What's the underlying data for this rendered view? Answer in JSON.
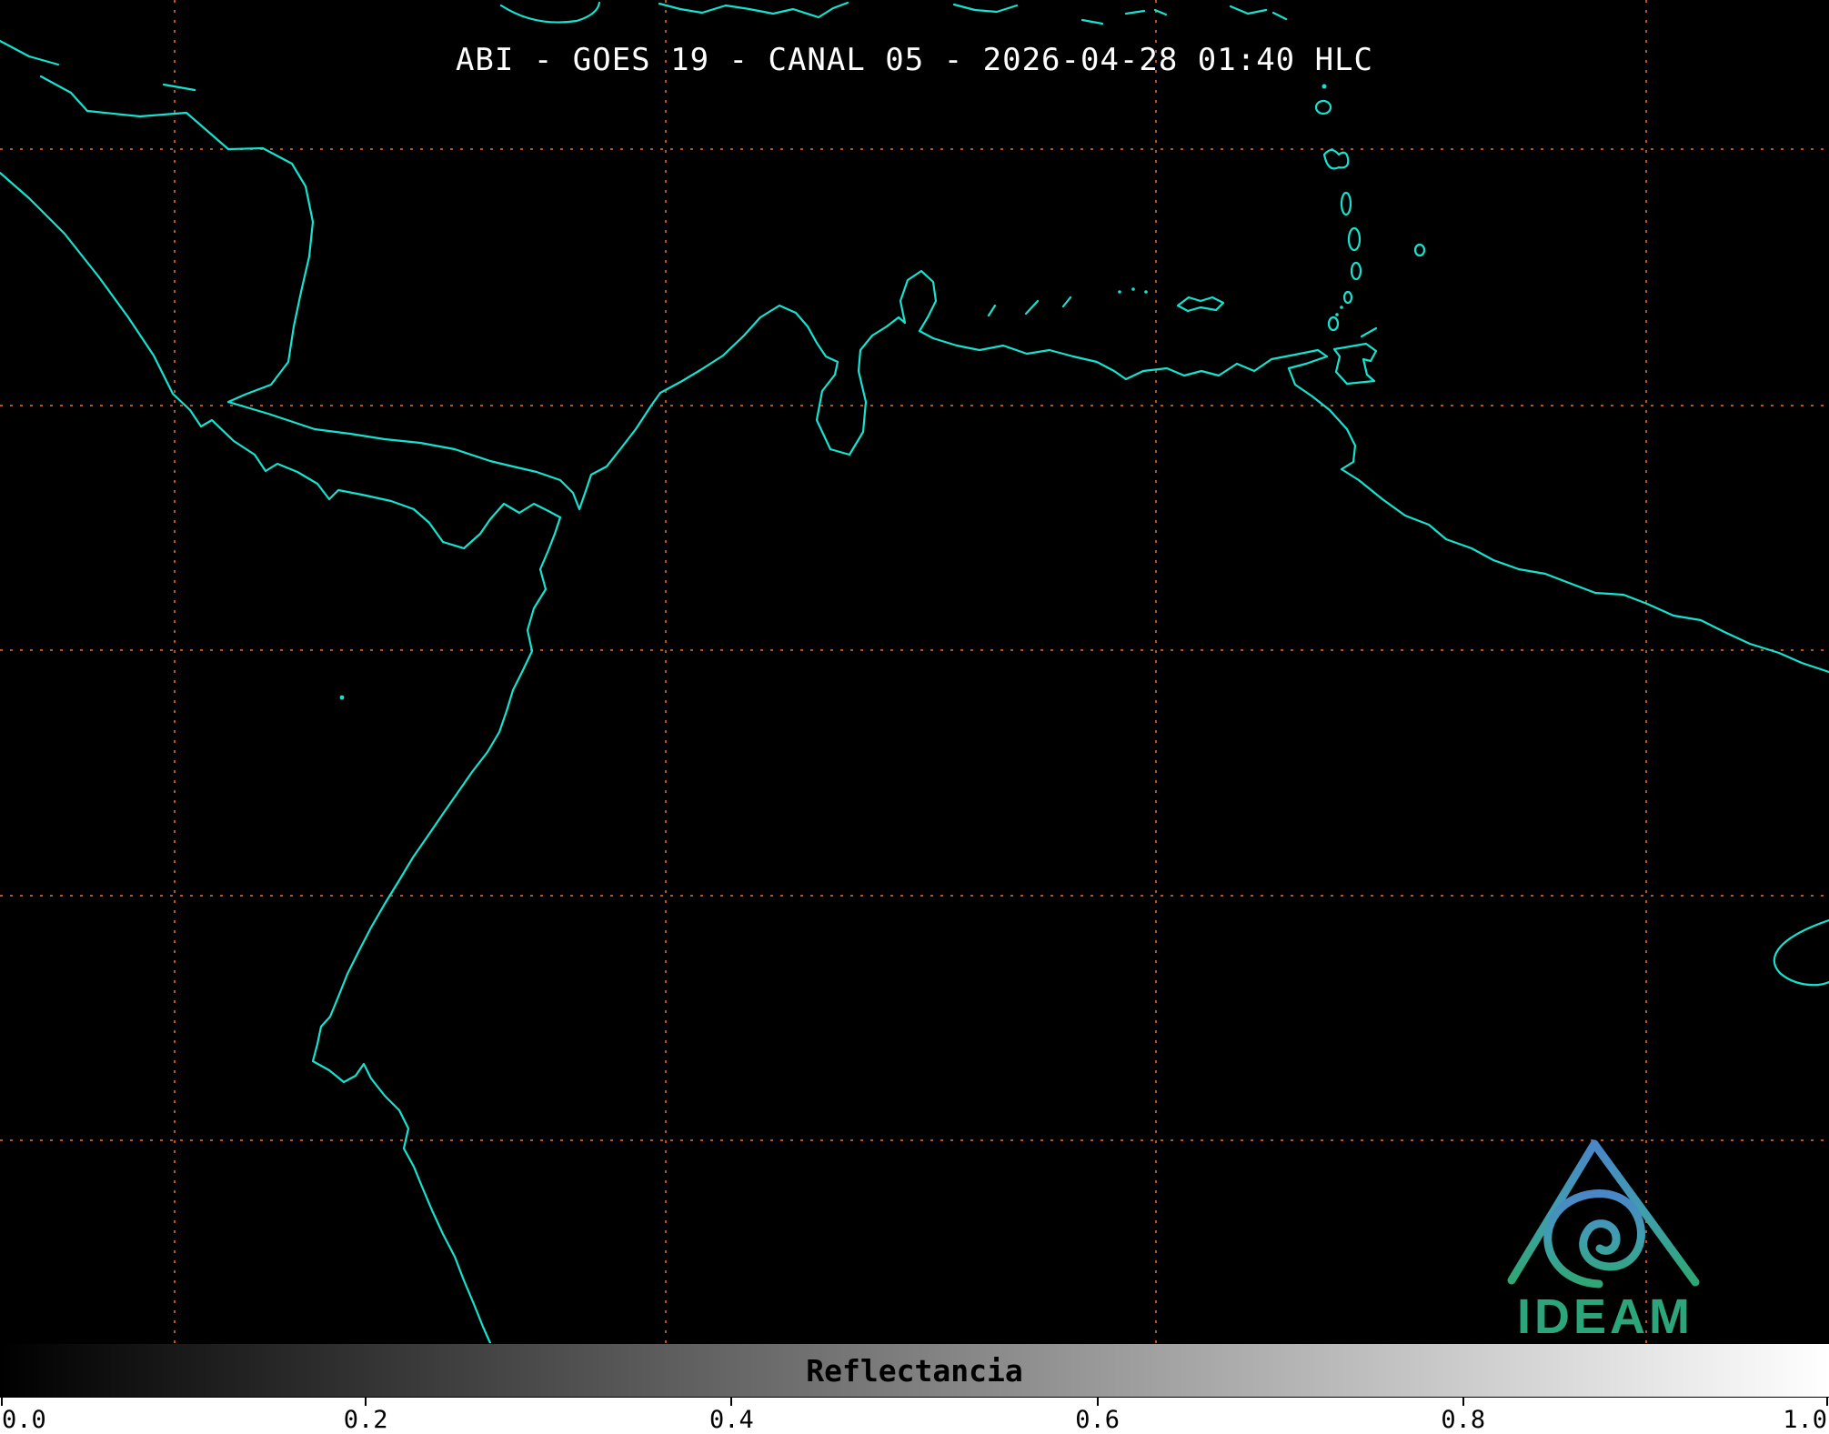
{
  "title": "ABI - GOES 19 - CANAL 05 - 2026-04-28 01:40 HLC",
  "map": {
    "background_color": "#000000",
    "coastline_color": "#16e3cf",
    "grid_color": "#bd5a1e",
    "title_color": "#ffffff"
  },
  "logo": {
    "text": "IDEAM",
    "text_color": "#2ca57c",
    "gradient_top": "#4a86c8",
    "gradient_bottom": "#2fa673"
  },
  "colorbar": {
    "label": "Reflectancia",
    "min": "0.0",
    "max": "1.0",
    "ticks": [
      "0.0",
      "0.2",
      "0.4",
      "0.6",
      "0.8",
      "1.0"
    ],
    "gradient_start": "#000000",
    "gradient_end": "#ffffff"
  }
}
